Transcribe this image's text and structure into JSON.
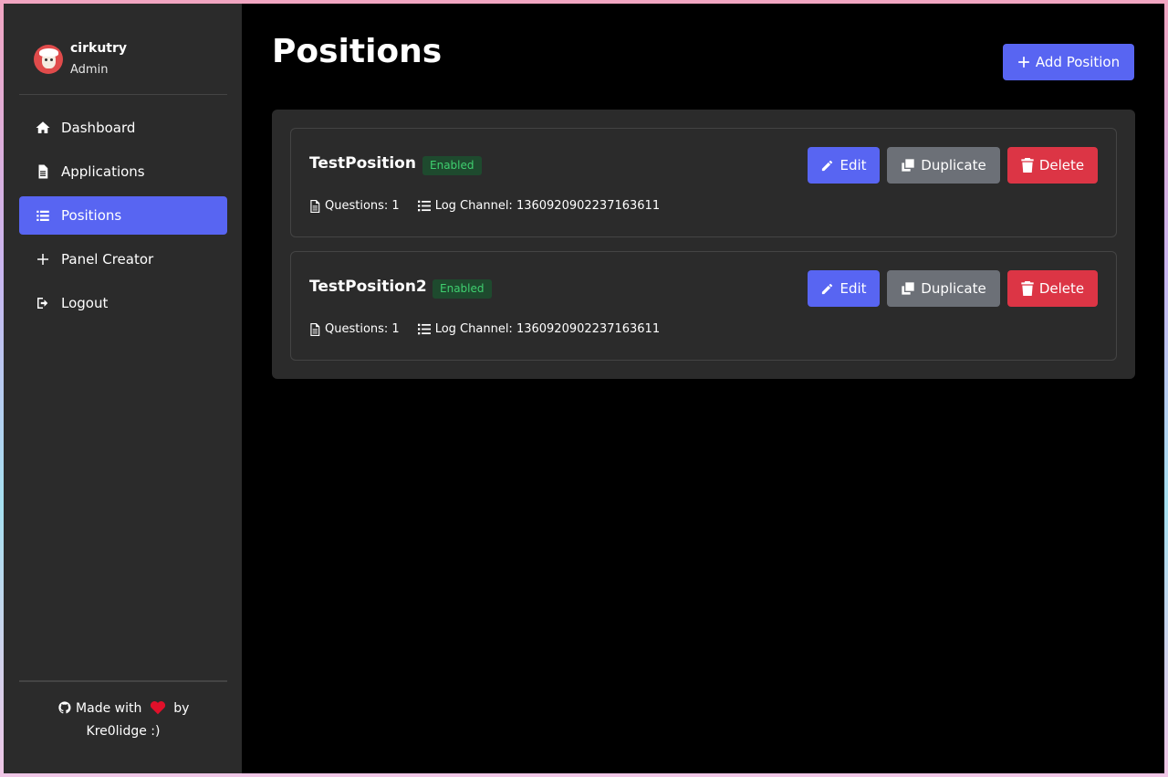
{
  "user": {
    "name": "cirkutry",
    "role": "Admin"
  },
  "nav": [
    {
      "label": "Dashboard",
      "icon": "home-icon",
      "active": false
    },
    {
      "label": "Applications",
      "icon": "document-icon",
      "active": false
    },
    {
      "label": "Positions",
      "icon": "list-icon",
      "active": true
    },
    {
      "label": "Panel Creator",
      "icon": "plus-icon",
      "active": false
    },
    {
      "label": "Logout",
      "icon": "logout-icon",
      "active": false
    }
  ],
  "footer": {
    "made_with": "Made with",
    "by": "by",
    "author": "Kre0lidge :)"
  },
  "page": {
    "title": "Positions",
    "add_button": "Add Position"
  },
  "positions": [
    {
      "name": "TestPosition",
      "status": "Enabled",
      "questions": "Questions: 1",
      "log_channel": "Log Channel: 1360920902237163611"
    },
    {
      "name": "TestPosition2",
      "status": "Enabled",
      "questions": "Questions: 1",
      "log_channel": "Log Channel: 1360920902237163611"
    }
  ],
  "buttons": {
    "edit": "Edit",
    "duplicate": "Duplicate",
    "delete": "Delete"
  },
  "colors": {
    "accent": "#5865f2",
    "danger": "#dc3545",
    "secondary": "#6c7077",
    "enabled": "#3fcf6f"
  }
}
